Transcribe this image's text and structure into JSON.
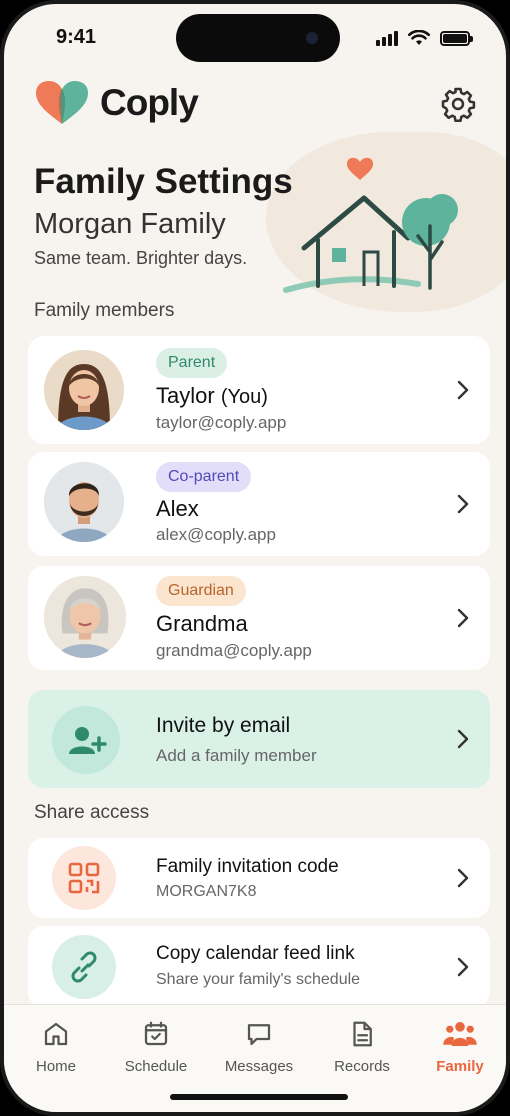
{
  "status_bar": {
    "time": "9:41"
  },
  "header": {
    "brand": "Coply"
  },
  "hero": {
    "title": "Family Settings",
    "family_name": "Morgan Family",
    "tagline": "Same team. Brighter days."
  },
  "members_section": {
    "label": "Family members"
  },
  "members": [
    {
      "role": "Parent",
      "name": "Taylor",
      "suffix": "(You)",
      "email": "taylor@coply.app"
    },
    {
      "role": "Co-parent",
      "name": "Alex",
      "suffix": "",
      "email": "alex@coply.app"
    },
    {
      "role": "Guardian",
      "name": "Grandma",
      "suffix": "",
      "email": "grandma@coply.app"
    }
  ],
  "invite": {
    "title": "Invite by email",
    "subtitle": "Add a family member"
  },
  "share_section": {
    "label": "Share access"
  },
  "share": [
    {
      "title": "Family invitation code",
      "subtitle": "MORGAN7K8",
      "icon": "qr-code-icon"
    },
    {
      "title": "Copy calendar feed link",
      "subtitle": "Share your family's schedule",
      "icon": "link-icon"
    }
  ],
  "tabs": [
    {
      "label": "Home",
      "icon": "home-icon"
    },
    {
      "label": "Schedule",
      "icon": "calendar-icon"
    },
    {
      "label": "Messages",
      "icon": "message-icon"
    },
    {
      "label": "Records",
      "icon": "document-icon"
    },
    {
      "label": "Family",
      "icon": "family-icon",
      "active": true
    }
  ],
  "colors": {
    "accent": "#e9673f",
    "teal": "#4fae92",
    "background": "#f7f4ef"
  }
}
